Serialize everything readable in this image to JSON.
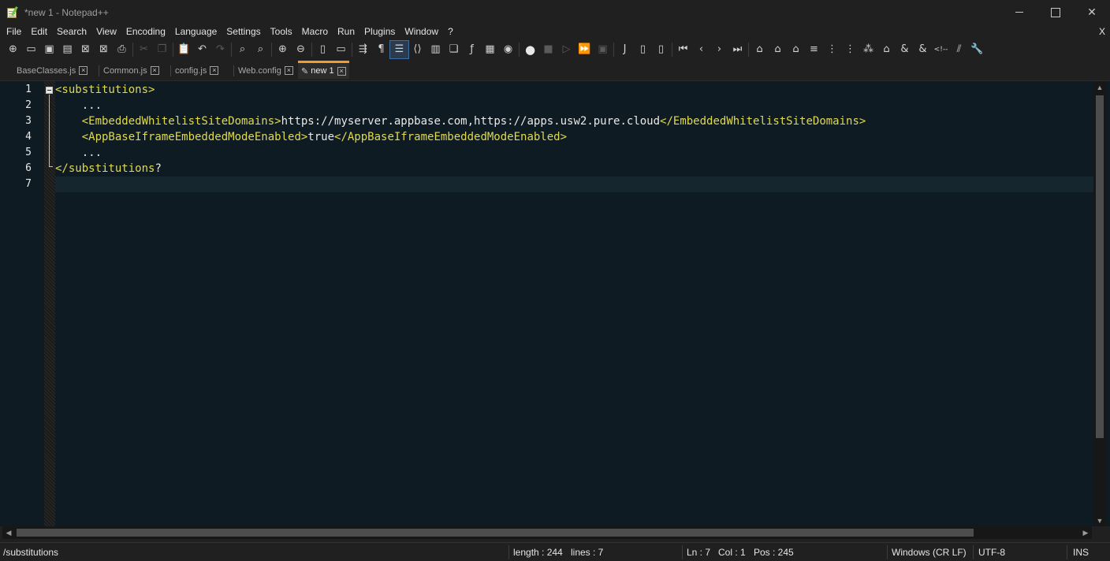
{
  "window": {
    "title": "*new 1 - Notepad++",
    "minimize_icon": "minimize-icon",
    "maximize_icon": "maximize-icon",
    "close_glyph": "✕"
  },
  "menu": {
    "items": [
      "File",
      "Edit",
      "Search",
      "View",
      "Encoding",
      "Language",
      "Settings",
      "Tools",
      "Macro",
      "Run",
      "Plugins",
      "Window",
      "?"
    ],
    "close_label": "X"
  },
  "toolbar": {
    "buttons": [
      {
        "name": "new-file-icon",
        "glyph": "⊕"
      },
      {
        "name": "open-file-icon",
        "glyph": "▭"
      },
      {
        "name": "save-icon",
        "glyph": "▣"
      },
      {
        "name": "save-all-icon",
        "glyph": "▤"
      },
      {
        "name": "close-file-icon",
        "glyph": "⊠"
      },
      {
        "name": "close-all-icon",
        "glyph": "⊠"
      },
      {
        "name": "print-icon",
        "glyph": "⎙"
      },
      {
        "name": "cut-icon",
        "glyph": "✂",
        "dim": true
      },
      {
        "name": "copy-icon",
        "glyph": "❐",
        "dim": true
      },
      {
        "name": "paste-icon",
        "glyph": "📋"
      },
      {
        "name": "undo-icon",
        "glyph": "↶"
      },
      {
        "name": "redo-icon",
        "glyph": "↷",
        "dim": true
      },
      {
        "name": "find-icon",
        "glyph": "⌕"
      },
      {
        "name": "replace-icon",
        "glyph": "⌕"
      },
      {
        "name": "zoom-in-icon",
        "glyph": "⊕"
      },
      {
        "name": "zoom-out-icon",
        "glyph": "⊖"
      },
      {
        "name": "sync-vertical-icon",
        "glyph": "▯"
      },
      {
        "name": "sync-horizontal-icon",
        "glyph": "▭"
      },
      {
        "name": "word-wrap-icon",
        "glyph": "⇶"
      },
      {
        "name": "show-all-chars-icon",
        "glyph": "¶"
      },
      {
        "name": "indent-guide-icon",
        "glyph": "☰",
        "active": true
      },
      {
        "name": "xml-tag-icon",
        "glyph": "⟨⟩"
      },
      {
        "name": "doc-map-icon",
        "glyph": "▥"
      },
      {
        "name": "doc-list-icon",
        "glyph": "❏"
      },
      {
        "name": "function-list-icon",
        "glyph": "ƒ"
      },
      {
        "name": "folder-as-workspace-icon",
        "glyph": "▦"
      },
      {
        "name": "monitoring-icon",
        "glyph": "◉"
      },
      {
        "name": "record-macro-icon",
        "glyph": "●",
        "rec": true
      },
      {
        "name": "stop-macro-icon",
        "glyph": "■",
        "dim": true
      },
      {
        "name": "play-macro-icon",
        "glyph": "▷",
        "dim": true
      },
      {
        "name": "run-macro-multiple-icon",
        "glyph": "⏩"
      },
      {
        "name": "save-macro-icon",
        "glyph": "▣",
        "dim": true
      },
      {
        "name": "plugin-j-icon",
        "glyph": "J"
      },
      {
        "name": "plugin-doc-icon",
        "glyph": "▯"
      },
      {
        "name": "plugin-doc2-icon",
        "glyph": "▯"
      },
      {
        "name": "first-icon",
        "glyph": "⏮"
      },
      {
        "name": "prev-icon",
        "glyph": "‹"
      },
      {
        "name": "next-icon",
        "glyph": "›"
      },
      {
        "name": "last-icon",
        "glyph": "⏭"
      },
      {
        "name": "plugin-a-icon",
        "glyph": "⌂"
      },
      {
        "name": "plugin-b-icon",
        "glyph": "⌂"
      },
      {
        "name": "plugin-c-icon",
        "glyph": "⌂"
      },
      {
        "name": "plugin-d-icon",
        "glyph": "≡"
      },
      {
        "name": "plugin-e-icon",
        "glyph": "⋮"
      },
      {
        "name": "plugin-f-icon",
        "glyph": "⋮"
      },
      {
        "name": "plugin-g-icon",
        "glyph": "⁂"
      },
      {
        "name": "plugin-h-icon",
        "glyph": "⌂"
      },
      {
        "name": "ampersand-icon",
        "glyph": "&"
      },
      {
        "name": "ampersand-slash-icon",
        "glyph": "&"
      },
      {
        "name": "comment-icon",
        "glyph": "<!--"
      },
      {
        "name": "uncomment-icon",
        "glyph": "⫽"
      },
      {
        "name": "settings-wrench-icon",
        "glyph": "🔧"
      }
    ]
  },
  "tabs": [
    {
      "label": "BaseClasses.js",
      "close": "×"
    },
    {
      "label": "Common.js",
      "close": "×"
    },
    {
      "label": "config.js",
      "close": "×"
    },
    {
      "label": "Web.config",
      "close": "×"
    },
    {
      "label": "new 1",
      "close": "×",
      "active": true
    }
  ],
  "editor": {
    "line_numbers": [
      "1",
      "2",
      "3",
      "4",
      "5",
      "6",
      "7"
    ],
    "current_line": 7,
    "lines": [
      [
        {
          "t": "tag",
          "v": "<substitutions>"
        }
      ],
      [
        {
          "t": "txt",
          "v": "    ..."
        }
      ],
      [
        {
          "t": "txt",
          "v": "    "
        },
        {
          "t": "tag",
          "v": "<EmbeddedWhitelistSiteDomains>"
        },
        {
          "t": "txt",
          "v": "https://myserver.appbase.com,https://apps.usw2.pure.cloud"
        },
        {
          "t": "tag",
          "v": "</EmbeddedWhitelistSiteDomains>"
        }
      ],
      [
        {
          "t": "txt",
          "v": "    "
        },
        {
          "t": "tag",
          "v": "<AppBaseIframeEmbeddedModeEnabled>"
        },
        {
          "t": "txt",
          "v": "true"
        },
        {
          "t": "tag",
          "v": "</AppBaseIframeEmbeddedModeEnabled>"
        }
      ],
      [
        {
          "t": "txt",
          "v": "    ..."
        }
      ],
      [
        {
          "t": "tag",
          "v": "</substitutions"
        },
        {
          "t": "txt",
          "v": "?"
        }
      ],
      []
    ]
  },
  "status": {
    "path": "/substitutions",
    "length": "length : 244",
    "lines": "lines : 7",
    "ln": "Ln : 7",
    "col": "Col : 1",
    "pos": "Pos : 245",
    "eol": "Windows (CR LF)",
    "encoding": "UTF-8",
    "mode": "INS"
  },
  "colors": {
    "editor_bg": "#0f1b22",
    "tag": "#e0d94e",
    "active_tab_accent": "#f29b2e"
  }
}
